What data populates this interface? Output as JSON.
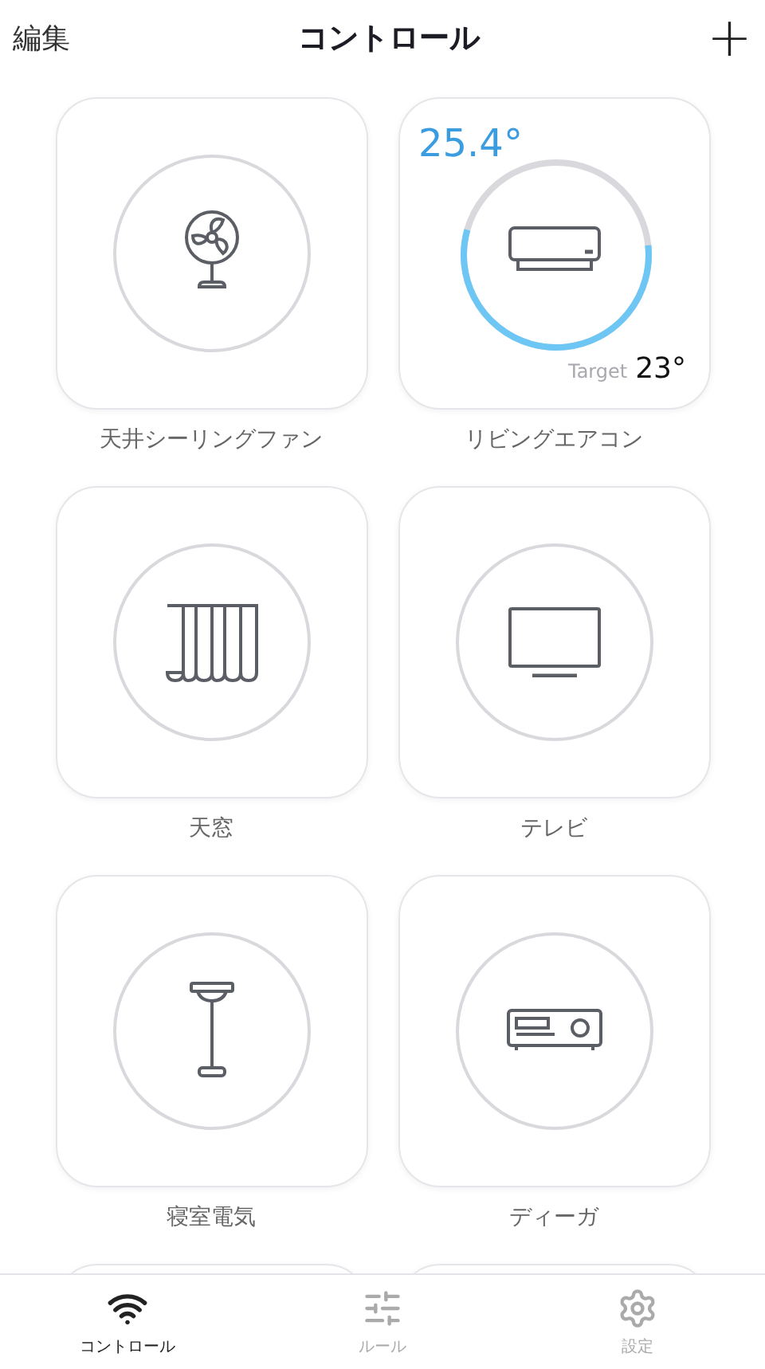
{
  "header": {
    "edit": "編集",
    "title": "コントロール",
    "add": "+"
  },
  "devices": [
    {
      "kind": "fan",
      "label": "天井シーリングファン"
    },
    {
      "kind": "ac",
      "label": "リビングエアコン"
    },
    {
      "kind": "curtain",
      "label": "天窓"
    },
    {
      "kind": "tv",
      "label": "テレビ"
    },
    {
      "kind": "lamp",
      "label": "寝室電気"
    },
    {
      "kind": "receiver",
      "label": "ディーガ"
    },
    {
      "kind": "cut"
    },
    {
      "kind": "cut"
    }
  ],
  "thermostat": {
    "current": "25.4°",
    "target_label": "Target",
    "target": "23°",
    "level": 0.56
  },
  "tabs": [
    {
      "kind": "wifi",
      "label": "コントロール",
      "selected": true
    },
    {
      "kind": "sliders",
      "label": "ルール",
      "selected": false
    },
    {
      "kind": "gear",
      "label": "設定",
      "selected": false
    }
  ]
}
